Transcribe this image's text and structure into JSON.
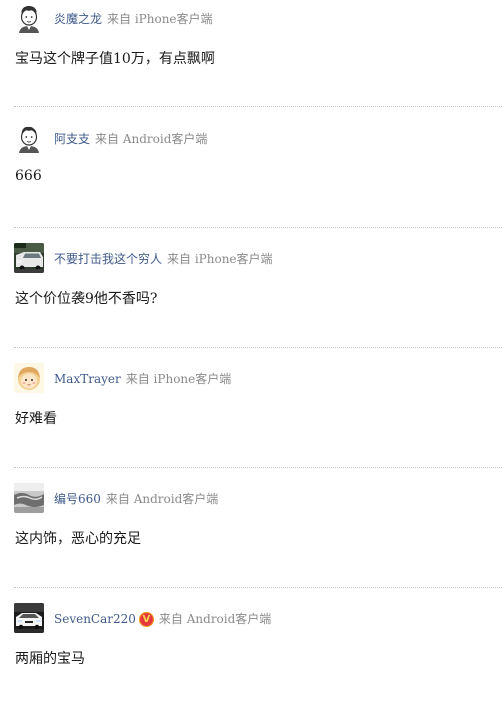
{
  "comments": [
    {
      "username": "炎魔之龙",
      "source": "来自 iPhone客户端",
      "text": "宝马这个牌子值10万，有点飘啊",
      "avatar": "cartoon-man-avatar-icon"
    },
    {
      "username": "阿支支",
      "source": "来自 Android客户端",
      "text": "666",
      "avatar": "cartoon-man-avatar-icon"
    },
    {
      "username": "不要打击我这个穷人",
      "source": "来自 iPhone客户端",
      "text": "这个价位袭9他不香吗?",
      "avatar": "car-photo-avatar"
    },
    {
      "username": "MaxTrayer",
      "source": "来自 iPhone客户端",
      "text": "好难看",
      "avatar": "cartoon-girl-avatar-icon"
    },
    {
      "username": "编号660",
      "source": "来自 Android客户端",
      "text": "这内饰，恶心的充足",
      "avatar": "photo-avatar"
    },
    {
      "username": "SevenCar220",
      "source": "来自 Android客户端",
      "text": "两厢的宝马",
      "avatar": "car-photo-avatar",
      "vip_badge": "V"
    }
  ]
}
